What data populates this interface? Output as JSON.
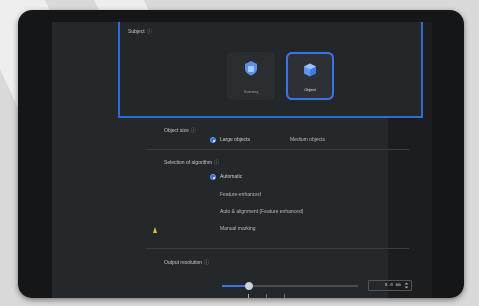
{
  "section_target": {
    "title": "Subject",
    "tiles": [
      {
        "label": "Scenery",
        "icon": "shield-icon",
        "selected": false
      },
      {
        "label": "Object",
        "icon": "cube-icon",
        "selected": true
      }
    ]
  },
  "section_size": {
    "title": "Object size",
    "options": [
      {
        "label": "Large objects",
        "selected": true
      },
      {
        "label": "Medium objects",
        "selected": false
      }
    ]
  },
  "section_mode": {
    "title": "Selection of algorithm",
    "options": [
      {
        "label": "Automatic",
        "selected": true
      },
      {
        "label": "Feature-enhanced",
        "selected": false
      },
      {
        "label": "Auto & alignment (Feature enhanced)",
        "selected": false
      },
      {
        "label": "Manual marking",
        "selected": false
      }
    ]
  },
  "section_slider": {
    "title": "Output resolution",
    "value_text": "0.0  mm",
    "fraction": 0.2
  },
  "colors": {
    "accent": "#2d6bd6",
    "warning_mark": "#e0c23a"
  }
}
